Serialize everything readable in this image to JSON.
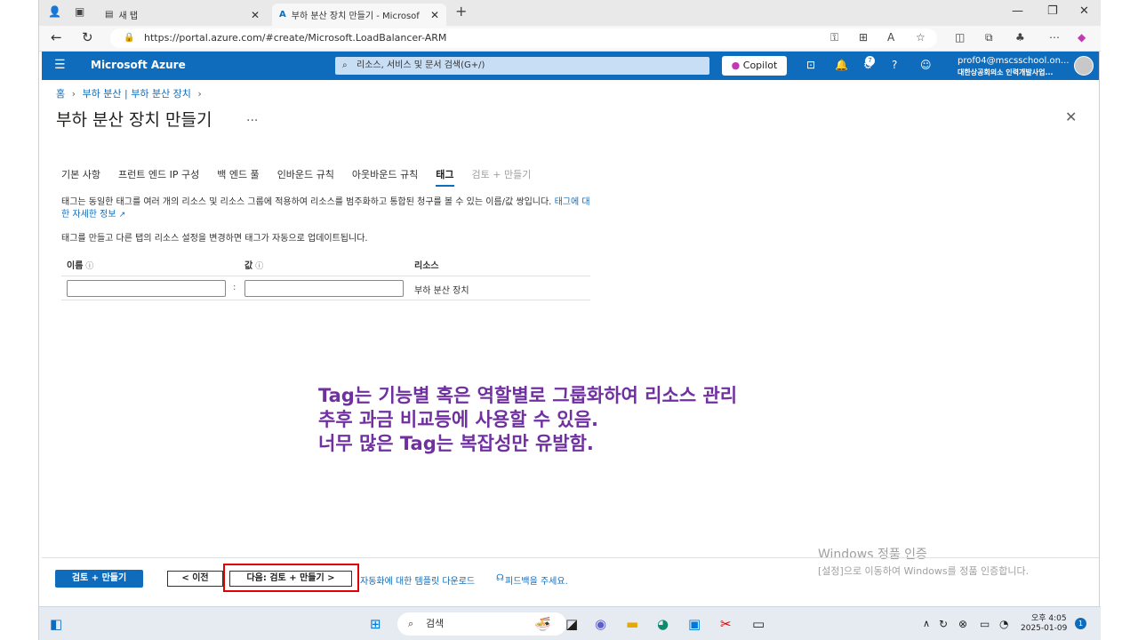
{
  "browser": {
    "tabs": [
      {
        "label": "새 탭"
      },
      {
        "label": "부하 분산 장치 만들기 - Microsof"
      }
    ],
    "url": "https://portal.azure.com/#create/Microsoft.LoadBalancer-ARM"
  },
  "azure": {
    "brand": "Microsoft Azure",
    "search_placeholder": "리소스, 서비스 및 문서 검색(G+/)",
    "copilot_label": "Copilot",
    "notification_count": "7",
    "account_email": "prof04@mscsschool.on...",
    "account_org": "대한상공회의소 인력개발사업..."
  },
  "page": {
    "breadcrumb": [
      "홈",
      "부하 분산 | 부하 분산 장치"
    ],
    "title": "부하 분산 장치 만들기",
    "more": "...",
    "tabs": [
      {
        "label": "기본 사항"
      },
      {
        "label": "프런트 엔드 IP 구성"
      },
      {
        "label": "백 엔드 풀"
      },
      {
        "label": "인바운드 규칙"
      },
      {
        "label": "아웃바운드 규칙"
      },
      {
        "label": "태그"
      },
      {
        "label": "검토 + 만들기"
      }
    ],
    "description": "태그는 동일한 태그를 여러 개의 리소스 및 리소스 그룹에 적용하여 리소스를 범주화하고 통합된 청구를 볼 수 있는 이름/값 쌍입니다.",
    "description_link": "태그에 대한 자세한 정보",
    "description2": "태그를 만들고 다른 탭의 리소스 설정을 변경하면 태그가 자동으로 업데이트됩니다.",
    "table": {
      "col_name": "이름",
      "col_value": "값",
      "col_resource": "리소스",
      "row_resource": "부하 분산 장치",
      "name_value": "",
      "value_value": ""
    }
  },
  "overlay_text": "Tag는 기능별 혹은 역할별로 그룹화하여 리소스 관리\n추후 과금 비교등에 사용할 수 있음.\n너무 많은 Tag는 복잡성만 유발함.",
  "watermark": {
    "line1": "Windows 정품 인증",
    "line2": "[설정]으로 이동하여 Windows를 정품 인증합니다."
  },
  "footer": {
    "review_create": "검토 + 만들기",
    "previous": "< 이전",
    "next": "다음: 검토 + 만들기 >",
    "template_link": "자동화에 대한 템플릿 다운로드",
    "feedback_link": "피드백을 주세요."
  },
  "taskbar": {
    "search_placeholder": "검색",
    "time": "오후 4:05",
    "date": "2025-01-09",
    "notification_count": "1"
  },
  "colors": {
    "azure_blue": "#0f6cbd",
    "overlay_purple": "#7030a0",
    "highlight_red": "#e00000"
  }
}
